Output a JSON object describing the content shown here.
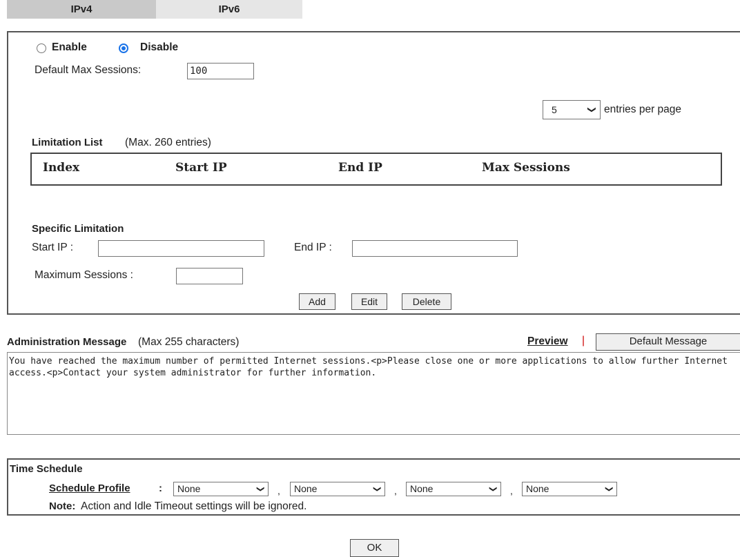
{
  "tabs": {
    "ipv4": "IPv4",
    "ipv6": "IPv6"
  },
  "status": {
    "enable_label": "Enable",
    "disable_label": "Disable",
    "selected": "Disable"
  },
  "default_max_sessions": {
    "label": "Default Max Sessions:",
    "value": "100"
  },
  "pagination": {
    "entries_value": "5",
    "entries_label": "entries per page"
  },
  "limitation_list": {
    "title": "Limitation List",
    "subtitle": "(Max. 260 entries)",
    "columns": [
      "Index",
      "Start IP",
      "End IP",
      "Max Sessions"
    ]
  },
  "specific_limitation": {
    "title": "Specific Limitation",
    "start_ip_label": "Start IP :",
    "start_ip_value": "",
    "end_ip_label": "End IP :",
    "end_ip_value": "",
    "max_sessions_label": "Maximum Sessions :",
    "max_sessions_value": "",
    "buttons": {
      "add": "Add",
      "edit": "Edit",
      "delete": "Delete"
    }
  },
  "admin_message": {
    "title": "Administration Message",
    "subtitle": "(Max 255 characters)",
    "preview_link": "Preview",
    "separator": "|",
    "default_button": "Default Message",
    "text": "You have reached the maximum number of permitted Internet sessions.<p>Please close one or more applications to allow further Internet access.<p>Contact your system administrator for further information."
  },
  "time_schedule": {
    "title": "Time Schedule",
    "profile_label": "Schedule Profile",
    "profile_colon": ":",
    "profiles": [
      "None",
      "None",
      "None",
      "None"
    ],
    "separator": ",",
    "note_label": "Note:",
    "note_text": "Action and Idle Timeout settings will be ignored."
  },
  "ok_button": "OK",
  "colors": {
    "radio_accent": "#1a73e8",
    "preview_separator": "#cc0000"
  }
}
